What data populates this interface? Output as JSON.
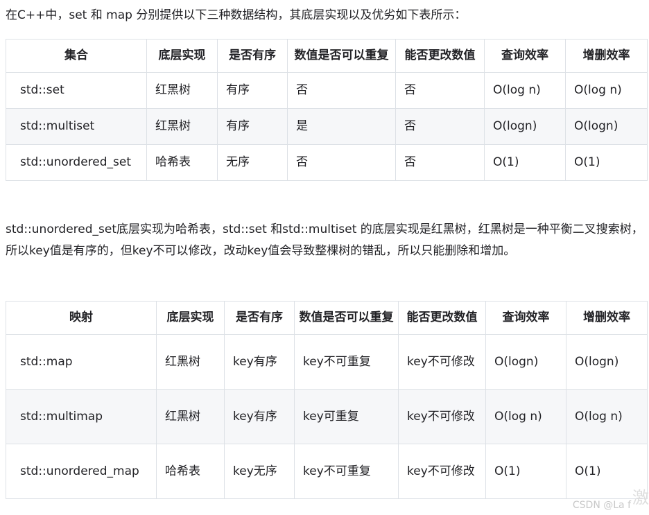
{
  "intro": "在C++中，set 和 map 分别提供以下三种数据结构，其底层实现以及优劣如下表所示：",
  "set_table": {
    "headers": [
      "集合",
      "底层实现",
      "是否有序",
      "数值是否可以重复",
      "能否更改数值",
      "查询效率",
      "增删效率"
    ],
    "rows": [
      [
        "std::set",
        "红黑树",
        "有序",
        "否",
        "否",
        "O(log n)",
        "O(log n)"
      ],
      [
        "std::multiset",
        "红黑树",
        "有序",
        "是",
        "否",
        "O(logn)",
        "O(logn)"
      ],
      [
        "std::unordered_set",
        "哈希表",
        "无序",
        "否",
        "否",
        "O(1)",
        "O(1)"
      ]
    ]
  },
  "paragraph": "std::unordered_set底层实现为哈希表，std::set 和std::multiset 的底层实现是红黑树，红黑树是一种平衡二叉搜索树，所以key值是有序的，但key不可以修改，改动key值会导致整棵树的错乱，所以只能删除和增加。",
  "map_table": {
    "headers": [
      "映射",
      "底层实现",
      "是否有序",
      "数值是否可以重复",
      "能否更改数值",
      "查询效率",
      "增删效率"
    ],
    "rows": [
      [
        "std::map",
        "红黑树",
        "key有序",
        "key不可重复",
        "key不可修改",
        "O(logn)",
        "O(logn)"
      ],
      [
        "std::multimap",
        "红黑树",
        "key有序",
        "key可重复",
        "key不可修改",
        "O(log n)",
        "O(log n)"
      ],
      [
        "std::unordered_map",
        "哈希表",
        "key无序",
        "key不可重复",
        "key不可修改",
        "O(1)",
        "O(1)"
      ]
    ]
  },
  "watermark": "CSDN @La f",
  "corner_char": "激"
}
